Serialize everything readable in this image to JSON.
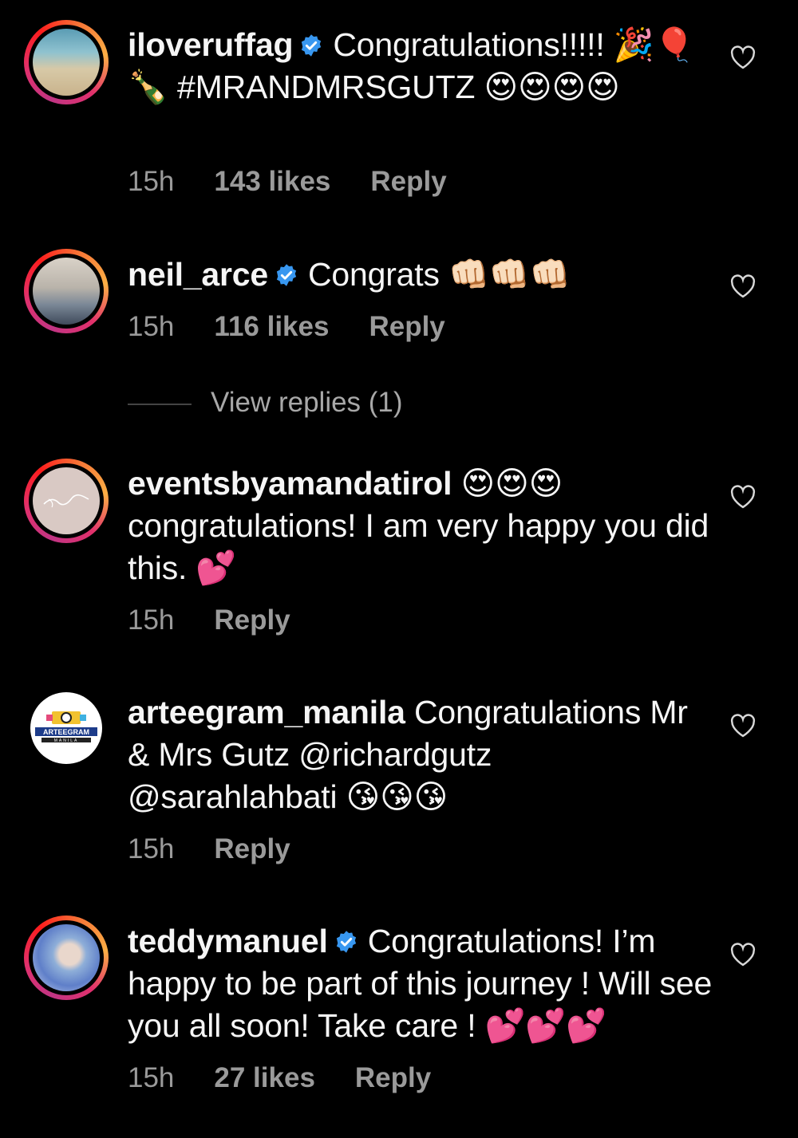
{
  "comments": [
    {
      "username": "iloveruffag",
      "verified": true,
      "text": "Congratulations!!!!! 🎉🎈🍾 #MRANDMRSGUTZ 😍😍😍😍",
      "time": "15h",
      "likes": "143 likes",
      "reply": "Reply"
    },
    {
      "username": "neil_arce",
      "verified": true,
      "text": "Congrats 👊🏻👊🏻👊🏻",
      "time": "15h",
      "likes": "116 likes",
      "reply": "Reply",
      "view_replies": "View replies (1)"
    },
    {
      "username": "eventsbyamandatirol",
      "verified": false,
      "text": "😍😍😍 congratulations! I am very happy you did this. 💕",
      "time": "15h",
      "likes": "",
      "reply": "Reply"
    },
    {
      "username": "arteegram_manila",
      "verified": false,
      "text_before": "Congratulations Mr & Mrs Gutz ",
      "mention1": "@richardgutz",
      "mention2": "@sarahlahbati",
      "text_after": " 😘😘😘",
      "time": "15h",
      "likes": "",
      "reply": "Reply",
      "avatar_logo_top": "ARTEEGRAM",
      "avatar_logo_bottom": "MANILA"
    },
    {
      "username": "teddymanuel",
      "verified": true,
      "text": "Congratulations! I’m happy to be part of this journey ! Will see you all soon! Take care ! 💕💕💕",
      "time": "15h",
      "likes": "27 likes",
      "reply": "Reply"
    }
  ],
  "colors": {
    "background": "#000000",
    "text": "#f5f5f5",
    "meta": "#9a9a9a",
    "verified": "#3897f0"
  },
  "icons": {
    "verified": "verified-badge-icon",
    "like": "heart-outline-icon"
  }
}
